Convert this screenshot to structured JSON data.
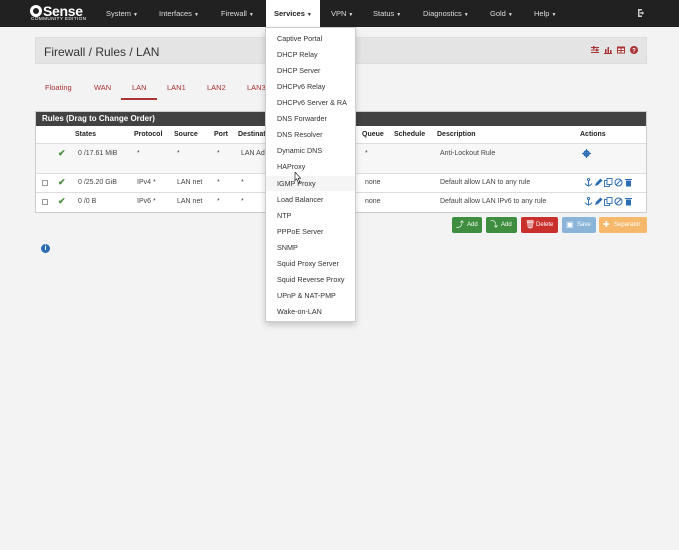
{
  "navbar": {
    "logo_text": "Sense",
    "logo_subtext": "COMMUNITY EDITION",
    "items": [
      {
        "label": "System"
      },
      {
        "label": "Interfaces"
      },
      {
        "label": "Firewall"
      },
      {
        "label": "Services"
      },
      {
        "label": "VPN"
      },
      {
        "label": "Status"
      },
      {
        "label": "Diagnostics"
      },
      {
        "label": "Gold"
      },
      {
        "label": "Help"
      }
    ]
  },
  "breadcrumb": {
    "text": "Firewall / Rules / LAN"
  },
  "tabs": [
    {
      "label": "Floating"
    },
    {
      "label": "WAN"
    },
    {
      "label": "LAN"
    },
    {
      "label": "LAN1"
    },
    {
      "label": "LAN2"
    },
    {
      "label": "LAN3"
    }
  ],
  "panel": {
    "title": "Rules (Drag to Change Order)",
    "headers": {
      "states": "States",
      "protocol": "Protocol",
      "source": "Source",
      "port": "Port",
      "destination": "Destinat",
      "queue": "Queue",
      "schedule": "Schedule",
      "description": "Description",
      "actions": "Actions"
    },
    "rows": [
      {
        "states": "0 /17.61 MiB",
        "protocol": "*",
        "source": "*",
        "port": "*",
        "destination": "LAN Ad",
        "queue": "*",
        "description": "Anti-Lockout Rule"
      },
      {
        "states": "0 /25.20 GiB",
        "protocol": "IPv4 *",
        "source": "LAN net",
        "port": "*",
        "destination": "*",
        "queue": "none",
        "description": "Default allow LAN to any rule"
      },
      {
        "states": "0 /0 B",
        "protocol": "IPv6 *",
        "source": "LAN net",
        "port": "*",
        "destination": "*",
        "queue": "none",
        "description": "Default allow LAN IPv6 to any rule"
      }
    ]
  },
  "buttons": {
    "add_top": "Add",
    "add_bottom": "Add",
    "delete": "Delete",
    "save": "Save",
    "separator": "Separator"
  },
  "services_menu": {
    "items": [
      "Captive Portal",
      "DHCP Relay",
      "DHCP Server",
      "DHCPv6 Relay",
      "DHCPv6 Server & RA",
      "DNS Forwarder",
      "DNS Resolver",
      "Dynamic DNS",
      "HAProxy",
      "IGMP Proxy",
      "Load Balancer",
      "NTP",
      "PPPoE Server",
      "SNMP",
      "Squid Proxy Server",
      "Squid Reverse Proxy",
      "UPnP & NAT-PMP",
      "Wake-on-LAN"
    ]
  },
  "colors": {
    "navbar": "#212121",
    "accent": "#a33333",
    "panel_header": "#424242",
    "button_green": "#3f8e3f",
    "button_red": "#c9302c",
    "button_blue": "#8ab5d9",
    "button_orange": "#f6b96b"
  }
}
